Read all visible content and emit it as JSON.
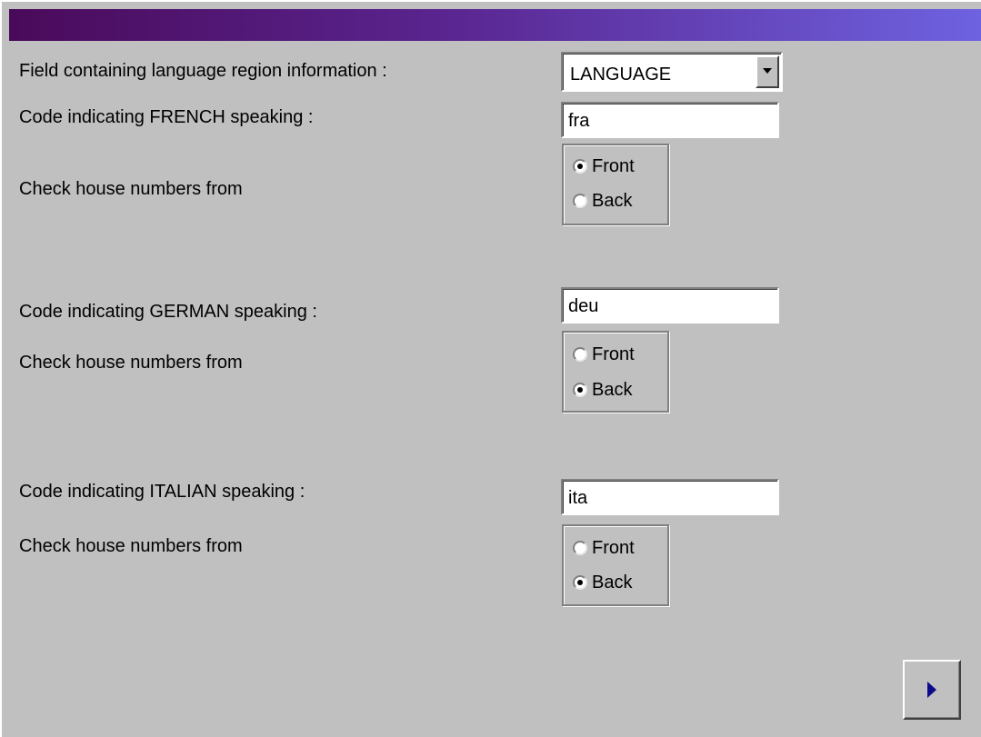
{
  "colors": {
    "background": "#c0c0c0",
    "title_gradient_start": "#4a0a5a",
    "title_gradient_end": "#6e62e0",
    "next_arrow": "#0b0b8a"
  },
  "language_field": {
    "label": "Field containing language region information :",
    "selected": "LANGUAGE"
  },
  "french": {
    "code_label": "Code indicating FRENCH speaking :",
    "code_value": "fra",
    "check_label": "Check house numbers from",
    "options": {
      "front": "Front",
      "back": "Back"
    },
    "selected": "Front"
  },
  "german": {
    "code_label": "Code indicating GERMAN speaking :",
    "code_value": "deu",
    "check_label": "Check house numbers from",
    "options": {
      "front": "Front",
      "back": "Back"
    },
    "selected": "Back"
  },
  "italian": {
    "code_label": "Code indicating ITALIAN speaking :",
    "code_value": "ita",
    "check_label": "Check house numbers from",
    "options": {
      "front": "Front",
      "back": "Back"
    },
    "selected": "Back"
  },
  "navigation": {
    "next_icon": "play-right-icon"
  }
}
